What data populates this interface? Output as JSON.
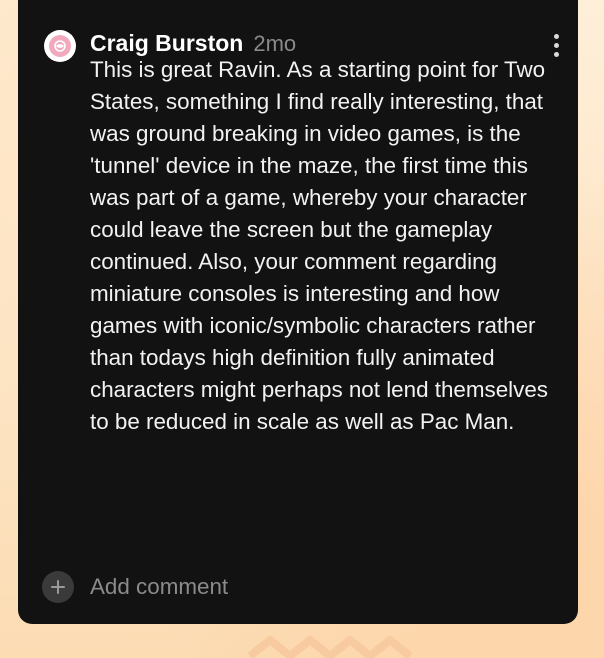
{
  "colors": {
    "card_background": "#121212",
    "author_text": "#ffffff",
    "timestamp_text": "#8a8a8a",
    "body_text": "#f2f2f2",
    "placeholder_text": "#8b8b8b",
    "avatar_accent": "#f2a9bd",
    "page_background": "#fde7c9"
  },
  "comment": {
    "avatar_icon": "avatar-icon",
    "author": "Craig Burston",
    "timestamp": "2mo",
    "menu_icon": "more-vertical-icon",
    "body": "This is great Ravin. As a starting point for Two States, something I find really interesting, that was ground breaking in video games, is the 'tunnel' device in the maze, the first time this was part of a game, whereby your character could leave the screen but the gameplay continued. Also, your comment regarding miniature consoles is interesting and how games with iconic/symbolic characters rather than todays high definition fully animated characters might perhaps not lend themselves to be reduced in scale as well as Pac Man."
  },
  "composer": {
    "icon": "plus-icon",
    "placeholder": "Add comment"
  }
}
